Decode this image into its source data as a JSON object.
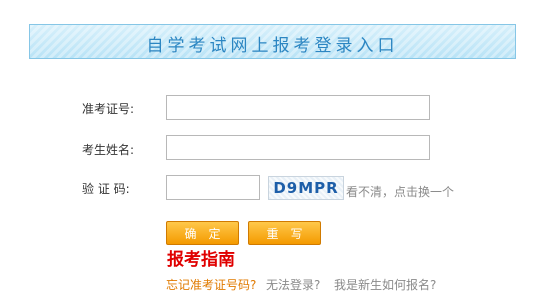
{
  "header": {
    "title": "自学考试网上报考登录入口"
  },
  "form": {
    "admission_label": "准考证号:",
    "admission_value": "",
    "name_label": "考生姓名:",
    "name_value": "",
    "captcha_label": "验 证 码:",
    "captcha_value": "",
    "captcha_image_text": "D9MPR",
    "refresh_text": "看不清，点击换一个"
  },
  "buttons": {
    "confirm": "确定",
    "reset": "重写"
  },
  "guide_title": "报考指南",
  "links": {
    "forgot": "忘记准考证号码?",
    "cannot_login": "无法登录?",
    "new_student": "我是新生如何报名?"
  },
  "colors": {
    "accent": "#f49a00",
    "banner_text": "#2c86c2",
    "guide": "#e00000"
  }
}
